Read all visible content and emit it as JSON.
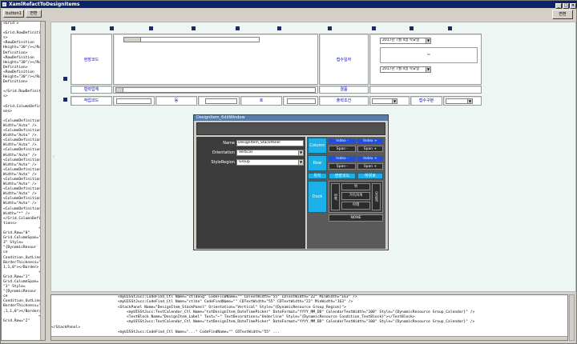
{
  "window": {
    "title": "XamlRefactToDesignItems"
  },
  "toolbar": {
    "button1_label": "button1",
    "apply_label": "변환",
    "convert_label": "변환"
  },
  "left_text": "<Grid >\n\n<Grid.RowDefinition\ns>\n<RowDefinition\nHeight=\"30\"/></Row\nDefinition>\n<RowDefinition\nHeight=\"30\"/></Row\nDefinition>\n<RowDefinition\nHeight=\"30\"/></Row\nDefinition>\n\n</Grid.RowDefinition\ns>\n\n<Grid.ColumnDefiniti\nons>\n\n<ColumnDefinition\nWidth=\"Auto\" />\n<ColumnDefinition\nWidth=\"Auto\" />\n<ColumnDefinition\nWidth=\"Auto\" />\n<ColumnDefinition\nWidth=\"Auto\" />\n<ColumnDefinition\nWidth=\"Auto\" />\n<ColumnDefinition\nWidth=\"Auto\" />\n<ColumnDefinition\nWidth=\"Auto\" />\n<ColumnDefinition\nWidth=\"Auto\" />\n<ColumnDefinition\nWidth=\"Auto\" />\n<ColumnDefinition\nWidth=\"*\" />\n</Grid.ColumnDefini\ntions>\n                <Border\nGrid.Row=\"0\"\nGrid.ColumnSpan=\"\n3\" Style=\n\"{DynamicResour\nce\nCondition_OutLine}\"\nBorderThickness=\"\n1,1,0\"></Border>\n                <Border\nGrid.Row=\"1\"\nGrid.ColumnSpan=\n\"3\" Style=\n\"{DynamicResour\nce\nCondition_OutLine}\"\nBorderThickness=\"1\n,1,1,0\"></Border>\n                <Border\nGrid.Row=\"2\"",
  "form": {
    "row1_label": "현장코드",
    "row2_label": "협력업체",
    "row3_label": "작업코드",
    "row3_c2": "동",
    "row3_c3": "호",
    "row3_c4": "출력조건",
    "row3_c5": "접수구분",
    "r1_right_label": "접수일자",
    "date1": "2017년  7월  4일 목요일",
    "date_sep": "~",
    "date2": "2017년  7월  4일 목요일",
    "r2_right_label": "결품"
  },
  "dialog": {
    "title": "DesignItem_EditWindow",
    "name_label": "Name",
    "name_value": "DesignItem_StackPanel",
    "orientation_label": "Orientation",
    "orientation_value": "Vertical",
    "style_label": "StyleRegion",
    "style_value": "Group",
    "column_label": "Column",
    "row_label": "Row",
    "index_minus": "Index -",
    "index_plus": "Index +",
    "span_minus": "Span -",
    "span_plus": "Span +",
    "pos_label": "위치",
    "tab1": "현장코드",
    "tab2": "하위로",
    "dock_label": "Dock",
    "left_label": "왼쪽",
    "top_label": "위",
    "fill_label": "가득차게",
    "bottom_label": "아래",
    "right_label": "오른쪽",
    "none_label": "NONE"
  },
  "code_lines": [
    "                              <myUISStJucc:CodeFind_Ctl Name=\"ctldong\" CodeFindName=\"\" CDTextWidth=\"55\" CDTextWidth=\"22\" MinWidth=\"163\" />",
    "                              <myUISStJucc:CodeFind_Ctl Name=\"ctlho\" CodeFindName=\"\" CDTextWidth=\"55\" CDTextWidth=\"22\" MinWidth=\"163\" />",
    "                              <StackPanel Name=\"DesignItem_StackPanel\" Orientation=\"Vertical\" Style=\"{DynamicResource Group_Region}\">",
    "                                  <myUISStJucc:TextCalendar_Ctl Name=\"txtDesignItem_DateTimePicker\" DateFormat=\"YYYY_MM_DD\" CalendarTextWidth=\"100\" Style=\"{DynamicResource Group_Calendar}\" />",
    "                                  <TextBlock Name=\"DesignItem_Label\" Text=\"~\" TextDecorations=\"Underline\" Style=\"{DynamicResource Condition_TextBlock}\"></TextBlock>",
    "                                  <myUISStJucc:TextCalendar_Ctl Name=\"txtDesignItem_DateTimePicker\" DateFormat=\"YYYY_MM_DD\" CalendarTextWidth=\"100\" Style=\"{DynamicResource Group_Calendar}\" />",
    "</StackPanel>",
    "                              <myUISStJucc:CodeFind_Ctl Name=\"...\" CodeFindName=\"\" CDTextWidth=\"55\" ..."
  ]
}
